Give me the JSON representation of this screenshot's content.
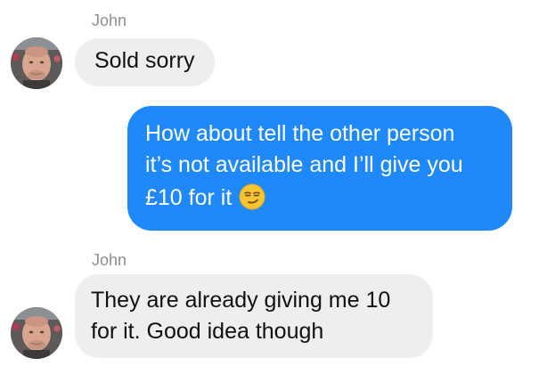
{
  "conversation": {
    "messages": [
      {
        "sender": "John",
        "direction": "incoming",
        "lines": [
          "Sold sorry"
        ]
      },
      {
        "sender": "",
        "direction": "outgoing",
        "lines": [
          "How about tell the other person",
          "it’s not available and I’ll give you",
          "£10 for it"
        ],
        "emoji": "smirking-face-icon"
      },
      {
        "sender": "John",
        "direction": "incoming",
        "lines": [
          "They are already giving me 10",
          "for it. Good idea though"
        ]
      }
    ]
  },
  "colors": {
    "outgoing_bubble": "#1f89fb",
    "incoming_bubble": "#eeeef0",
    "sender_name": "#8e8e93"
  }
}
